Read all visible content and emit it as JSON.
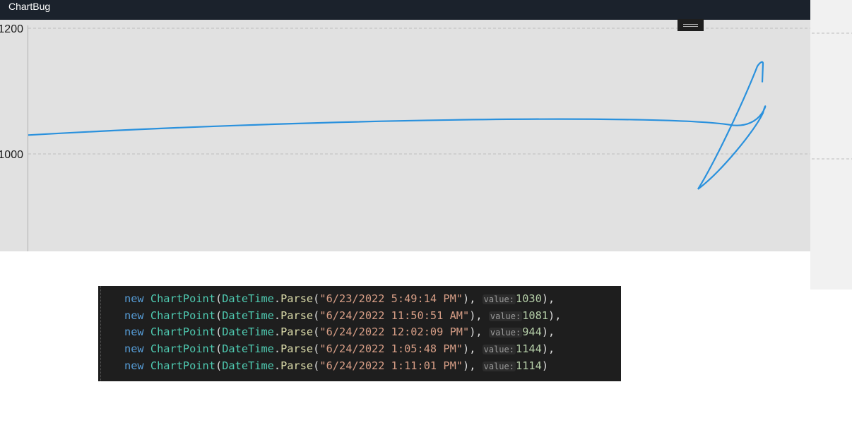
{
  "window": {
    "title": "ChartBug"
  },
  "chart_data": {
    "type": "line",
    "x": [
      "6/23/2022 5:49:14 PM",
      "6/24/2022 11:50:51 AM",
      "6/24/2022 12:02:09 PM",
      "6/24/2022 1:05:48 PM",
      "6/24/2022 1:11:01 PM"
    ],
    "series": [
      {
        "values": [
          1030,
          1081,
          944,
          1144,
          1114
        ]
      }
    ],
    "y_tick_labels": [
      "1200",
      "1000"
    ],
    "ylim": [
      820,
      1220
    ],
    "grid": true,
    "smooth": true,
    "line_color": "#2a91dd"
  },
  "code": {
    "lines": [
      {
        "kw": "new",
        "cls": "ChartPoint",
        "mtd": "Parse",
        "date": "\"6/23/2022 5:49:14 PM\"",
        "hint": "value:",
        "value": "1030",
        "end": "),"
      },
      {
        "kw": "new",
        "cls": "ChartPoint",
        "mtd": "Parse",
        "date": "\"6/24/2022 11:50:51 AM\"",
        "hint": "value:",
        "value": "1081",
        "end": "),"
      },
      {
        "kw": "new",
        "cls": "ChartPoint",
        "mtd": "Parse",
        "date": "\"6/24/2022 12:02:09 PM\"",
        "hint": "value:",
        "value": "944",
        "end": "),"
      },
      {
        "kw": "new",
        "cls": "ChartPoint",
        "mtd": "Parse",
        "date": "\"6/24/2022 1:05:48 PM\"",
        "hint": "value:",
        "value": "1144",
        "end": "),"
      },
      {
        "kw": "new",
        "cls": "ChartPoint",
        "mtd": "Parse",
        "date": "\"6/24/2022 1:11:01 PM\"",
        "hint": "value:",
        "value": "1114",
        "end": ")"
      }
    ],
    "datetime_class": "DateTime"
  }
}
